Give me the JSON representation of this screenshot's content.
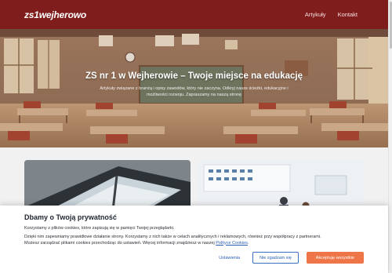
{
  "header": {
    "logo": "zs1wejherowo",
    "nav": [
      {
        "label": "Artykuły"
      },
      {
        "label": "Kontakt"
      }
    ]
  },
  "hero": {
    "title": "ZS nr 1 w Wejherowie – Twoje miejsce na edukację",
    "text": "Artykuły związane z branżą i opisy zawodów, który nie zaczyna. Odkryj nasze ścieżki, edukacyjne i możliwości rozwoju. Zapraszamy na naszą stronę"
  },
  "cookie": {
    "title": "Dbamy o Twoją prywatność",
    "line1": "Korzystamy z plików cookies, które zapisują się w pamięci Twojej przeglądarki.",
    "line2": "Dzięki nim zapewniamy prawidłowe działanie strony. Korzystamy z nich także w celach analitycznych i reklamowych, również przy współpracy z partnerami.",
    "line3_prefix": "Możesz zarządzać plikami cookies przechodząc do ustawień. Więcej informacji znajdziesz w naszej ",
    "policy_link": "Polityce Cookies",
    "line3_suffix": ".",
    "settings_label": "Ustawienia",
    "reject_label": "Nie zgadzam się",
    "accept_label": "Akceptuję wszystkie"
  },
  "colors": {
    "header": "#7f1d1c",
    "accent": "#ee7547",
    "link": "#2a5fb3"
  }
}
